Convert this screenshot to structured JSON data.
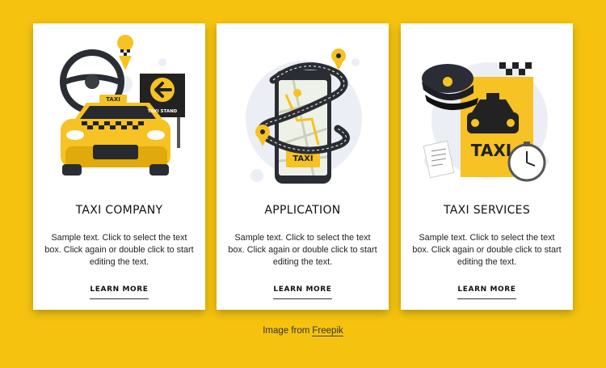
{
  "colors": {
    "background": "#f5c30f",
    "card": "#ffffff",
    "taxi_yellow": "#f6c224"
  },
  "cards": [
    {
      "illustration": "taxi-car-illustration",
      "sign_text": "TAXI STAND",
      "roof_text": "TAXI",
      "title": "TAXI COMPANY",
      "text": "Sample text. Click to select the text box. Click again or double click to start editing the text.",
      "link": "LEARN MORE"
    },
    {
      "illustration": "phone-map-illustration",
      "screen_text": "TAXI",
      "title": "APPLICATION",
      "text": "Sample text. Click to select the text box. Click again or double click to start editing the text.",
      "link": "LEARN MORE"
    },
    {
      "illustration": "taxi-services-illustration",
      "badge_text": "TAXI",
      "title": "TAXI SERVICES",
      "text": "Sample text. Click to select the text box. Click again or double click to start editing the text.",
      "link": "LEARN MORE"
    }
  ],
  "credit": {
    "prefix": "Image from",
    "link": "Freepik"
  }
}
